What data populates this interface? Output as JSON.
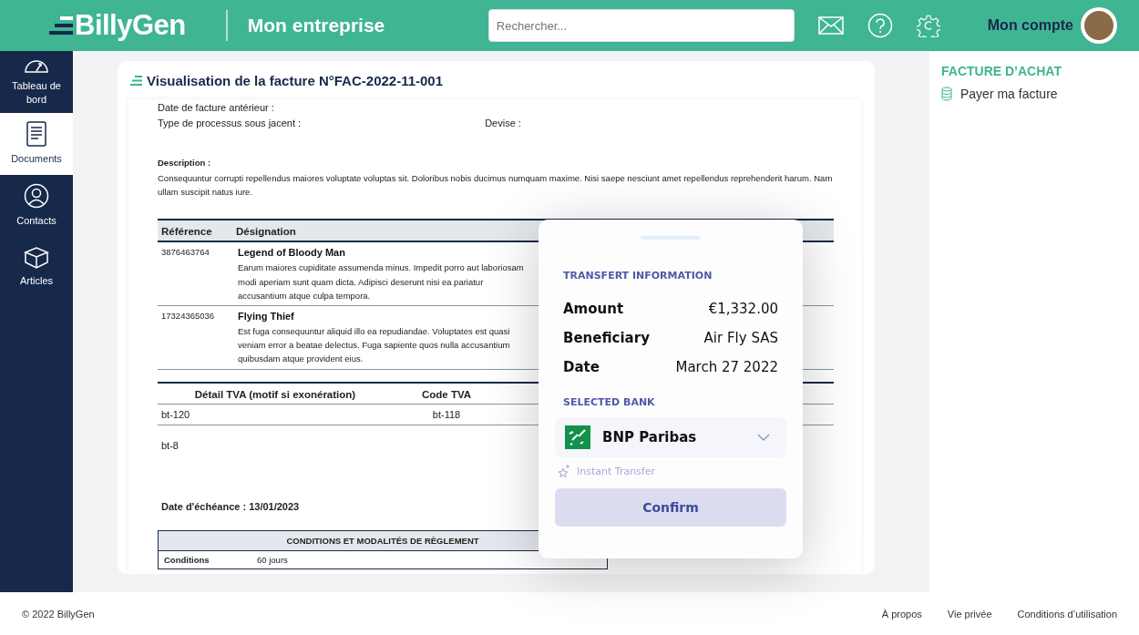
{
  "header": {
    "logo": "BillyGen",
    "title": "Mon entreprise",
    "search": {
      "placeholder": "Rechercher..."
    },
    "account": "Mon compte"
  },
  "sidebar": {
    "items": [
      {
        "label": "Tableau de bord",
        "kind": "gauge",
        "selected": false
      },
      {
        "label": "Documents",
        "kind": "document",
        "selected": true
      },
      {
        "label": "Contacts",
        "kind": "person",
        "selected": false
      },
      {
        "label": "Articles",
        "kind": "box",
        "selected": false
      }
    ]
  },
  "card": {
    "title": "Visualisation de la facture N°FAC-2022-11-001"
  },
  "invoice": {
    "previous_date": "Date de facture antérieur :",
    "process_type": "Type de processus sous jacent :",
    "currency": "Devise :",
    "description_label": "Description :",
    "description": "Consequuntur corrupti repellendus maiores voluptate voluptas sit. Doloribus nobis ducimus numquam maxime. Nisi saepe nesciunt amet repellendus reprehenderit harum. Nam ullam suscipit natus iure."
  },
  "lines_table": {
    "columns": [
      "Référence",
      "Désignation"
    ],
    "rows": [
      {
        "reference": "3876463764",
        "title": "Legend of Bloody Man",
        "text": "Earum maiores cupiditate assumenda minus. Impedit porro aut laboriosam modi aperiam sunt quam dicta. Adipisci deserunt nisi ea pariatur accusantium atque culpa tempora."
      },
      {
        "reference": "17324365036",
        "title": "Flying Thief",
        "text": "Est fuga consequuntur aliquid illo ea repudiandae. Voluptates est quasi veniam error a beatae delectus. Fuga sapiente quos nulla accusantium quibusdam atque provident eius."
      }
    ]
  },
  "tva_table": {
    "columns": [
      "Détail TVA (motif si exonération)",
      "Code TVA"
    ],
    "rows": [
      [
        "bt-120",
        "bt-118"
      ]
    ],
    "note": "bt-8"
  },
  "due_date": "Date d'échéance : 13/01/2023",
  "conditions": {
    "title": "CONDITIONS ET MODALITÉS DE RÈGLEMENT",
    "rows": [
      {
        "label": "Conditions",
        "value": "60 jours"
      }
    ]
  },
  "modal": {
    "section_title": "TRANSFERT INFORMATION",
    "rows": [
      {
        "label": "Amount",
        "value": "€1,332.00"
      },
      {
        "label": "Beneficiary",
        "value": "Air Fly SAS"
      },
      {
        "label": "Date",
        "value": "March 27  2022"
      }
    ],
    "bank_title": "SELECTED BANK",
    "bank": "BNP Paribas",
    "instant": "Instant Transfer",
    "confirm": "Confirm"
  },
  "right_panel": {
    "heading": "FACTURE D’ACHAT",
    "items": [
      {
        "label": "Payer ma facture"
      }
    ]
  },
  "footer": {
    "copyright": "© 2022 BillyGen",
    "links": [
      "À propos",
      "Vie privée",
      "Conditions d’utilisation"
    ]
  }
}
